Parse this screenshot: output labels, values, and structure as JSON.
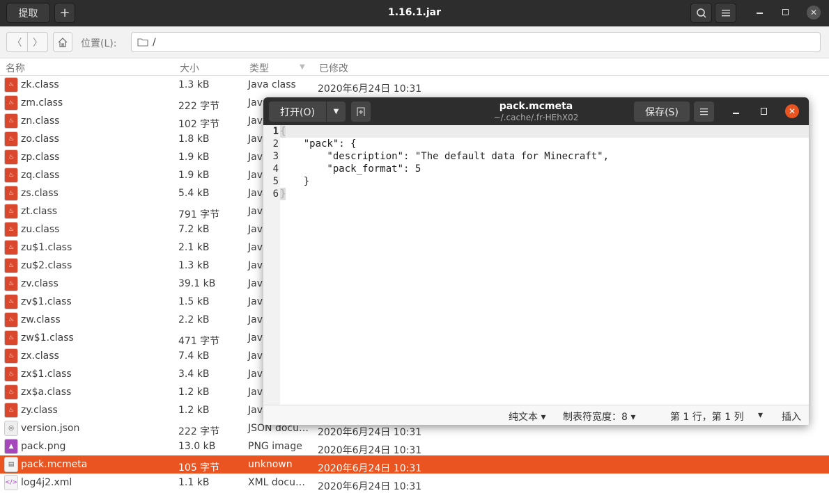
{
  "window": {
    "title": "1.16.1.jar",
    "extract_label": "提取",
    "add_label": "+",
    "search_icon": "search-icon",
    "menu_icon": "menu-icon"
  },
  "toolbar": {
    "back": "〈",
    "forward": "〉",
    "location_label": "位置(L):",
    "path": "/"
  },
  "columns": {
    "name": "名称",
    "size": "大小",
    "type": "类型",
    "modified": "已修改"
  },
  "files": [
    {
      "name": "zk.class",
      "size": "1.3 kB",
      "type": "Java class",
      "modified": "2020年6月24日 10:31",
      "icon": "java"
    },
    {
      "name": "zm.class",
      "size": "222 字节",
      "type": "Java class",
      "modified": "",
      "icon": "java"
    },
    {
      "name": "zn.class",
      "size": "102 字节",
      "type": "Java class",
      "modified": "",
      "icon": "java"
    },
    {
      "name": "zo.class",
      "size": "1.8 kB",
      "type": "Java class",
      "modified": "",
      "icon": "java"
    },
    {
      "name": "zp.class",
      "size": "1.9 kB",
      "type": "Java class",
      "modified": "",
      "icon": "java"
    },
    {
      "name": "zq.class",
      "size": "1.9 kB",
      "type": "Java class",
      "modified": "",
      "icon": "java"
    },
    {
      "name": "zs.class",
      "size": "5.4 kB",
      "type": "Java class",
      "modified": "",
      "icon": "java"
    },
    {
      "name": "zt.class",
      "size": "791 字节",
      "type": "Java class",
      "modified": "",
      "icon": "java"
    },
    {
      "name": "zu.class",
      "size": "7.2 kB",
      "type": "Java class",
      "modified": "",
      "icon": "java"
    },
    {
      "name": "zu$1.class",
      "size": "2.1 kB",
      "type": "Java class",
      "modified": "",
      "icon": "java"
    },
    {
      "name": "zu$2.class",
      "size": "1.3 kB",
      "type": "Java class",
      "modified": "",
      "icon": "java"
    },
    {
      "name": "zv.class",
      "size": "39.1 kB",
      "type": "Java class",
      "modified": "",
      "icon": "java"
    },
    {
      "name": "zv$1.class",
      "size": "1.5 kB",
      "type": "Java class",
      "modified": "",
      "icon": "java"
    },
    {
      "name": "zw.class",
      "size": "2.2 kB",
      "type": "Java class",
      "modified": "",
      "icon": "java"
    },
    {
      "name": "zw$1.class",
      "size": "471 字节",
      "type": "Java class",
      "modified": "",
      "icon": "java"
    },
    {
      "name": "zx.class",
      "size": "7.4 kB",
      "type": "Java class",
      "modified": "",
      "icon": "java"
    },
    {
      "name": "zx$1.class",
      "size": "3.4 kB",
      "type": "Java class",
      "modified": "",
      "icon": "java"
    },
    {
      "name": "zx$a.class",
      "size": "1.2 kB",
      "type": "Java class",
      "modified": "",
      "icon": "java"
    },
    {
      "name": "zy.class",
      "size": "1.2 kB",
      "type": "Java class",
      "modified": "",
      "icon": "java"
    },
    {
      "name": "version.json",
      "size": "222 字节",
      "type": "JSON docu…",
      "modified": "2020年6月24日 10:31",
      "icon": "json"
    },
    {
      "name": "pack.png",
      "size": "13.0 kB",
      "type": "PNG image",
      "modified": "2020年6月24日 10:31",
      "icon": "image"
    },
    {
      "name": "pack.mcmeta",
      "size": "105 字节",
      "type": "unknown",
      "modified": "2020年6月24日 10:31",
      "icon": "binary",
      "selected": true
    },
    {
      "name": "log4j2.xml",
      "size": "1.1 kB",
      "type": "XML docu…",
      "modified": "2020年6月24日 10:31",
      "icon": "xml"
    }
  ],
  "editor": {
    "open_label": "打开(O)",
    "title": "pack.mcmeta",
    "subtitle": "~/.cache/.fr-HEhX02",
    "save_label": "保存(S)",
    "lines": [
      "{",
      "    \"pack\": {",
      "        \"description\": \"The default data for Minecraft\",",
      "        \"pack_format\": 5",
      "    }",
      "}"
    ],
    "line_numbers": [
      "1",
      "2",
      "3",
      "4",
      "5",
      "6"
    ],
    "status": {
      "language": "纯文本 ▾",
      "tab_width": "制表符宽度：8 ▾",
      "position": "第 1 行，第 1 列",
      "pos_arrow": "▾",
      "mode": "插入"
    }
  },
  "colors": {
    "accent": "#e95420",
    "titlebar": "#2d2d2d"
  }
}
